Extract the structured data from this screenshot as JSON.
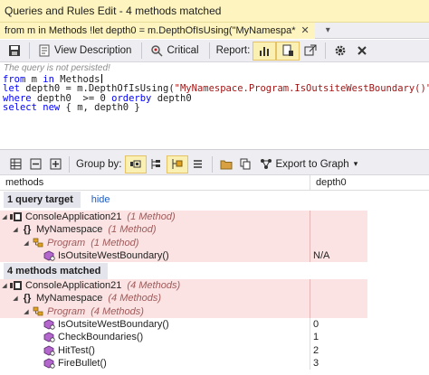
{
  "window": {
    "title": "Queries and Rules Edit  -  4 methods matched"
  },
  "tab": {
    "label": "from m in Methods !let depth0 = m.DepthOfIsUsing(\"MyNamespa*",
    "close": "✕",
    "overflow": "▾"
  },
  "toolbar": {
    "view_description": "View Description",
    "critical": "Critical",
    "report_label": "Report:"
  },
  "warning": "The query is not persisted!",
  "editor": {
    "line1": {
      "kw1": "from",
      "t1": " m ",
      "kw2": "in",
      "t2": " Methods"
    },
    "line2": {
      "kw1": "let",
      "t1": " depth0 = m.DepthOfIsUsing(",
      "str": "\"MyNamespace.Program.IsOutsiteWestBoundary()\"",
      "t2": ")"
    },
    "line3": {
      "kw1": "where",
      "t1": " depth0  >= 0 ",
      "kw2": "orderby",
      "t2": " depth0"
    },
    "line4": {
      "kw1": "select",
      "t1": " ",
      "kw2": "new",
      "t2": " { m, depth0 }"
    }
  },
  "results_toolbar": {
    "group_by_label": "Group by:",
    "export_label": "Export to Graph",
    "export_arrow": "▾"
  },
  "columns": {
    "methods": "methods",
    "depth0": "depth0"
  },
  "query_target": {
    "title": "1 query target",
    "hide": "hide",
    "rows": [
      {
        "name": "ConsoleApplication21",
        "note": "(1 Method)",
        "value": ""
      },
      {
        "name": "MyNamespace",
        "note": "(1 Method)",
        "value": ""
      },
      {
        "name": "Program",
        "note": "(1 Method)",
        "value": ""
      },
      {
        "name": "IsOutsiteWestBoundary()",
        "note": "",
        "value": "N/A"
      }
    ]
  },
  "matched": {
    "title": "4 methods matched",
    "rows": [
      {
        "name": "ConsoleApplication21",
        "note": "(4 Methods)",
        "value": ""
      },
      {
        "name": "MyNamespace",
        "note": "(4 Methods)",
        "value": ""
      },
      {
        "name": "Program",
        "note": "(4 Methods)",
        "value": ""
      },
      {
        "name": "IsOutsiteWestBoundary()",
        "note": "",
        "value": "0"
      },
      {
        "name": "CheckBoundaries()",
        "note": "",
        "value": "1"
      },
      {
        "name": "HitTest()",
        "note": "",
        "value": "2"
      },
      {
        "name": "FireBullet()",
        "note": "",
        "value": "3"
      }
    ]
  },
  "colors": {
    "title_bg": "#fdf4bf",
    "row_pink": "#fbe3e3",
    "keyword": "#0000ff",
    "string": "#a31515",
    "link": "#1e5cc8"
  }
}
